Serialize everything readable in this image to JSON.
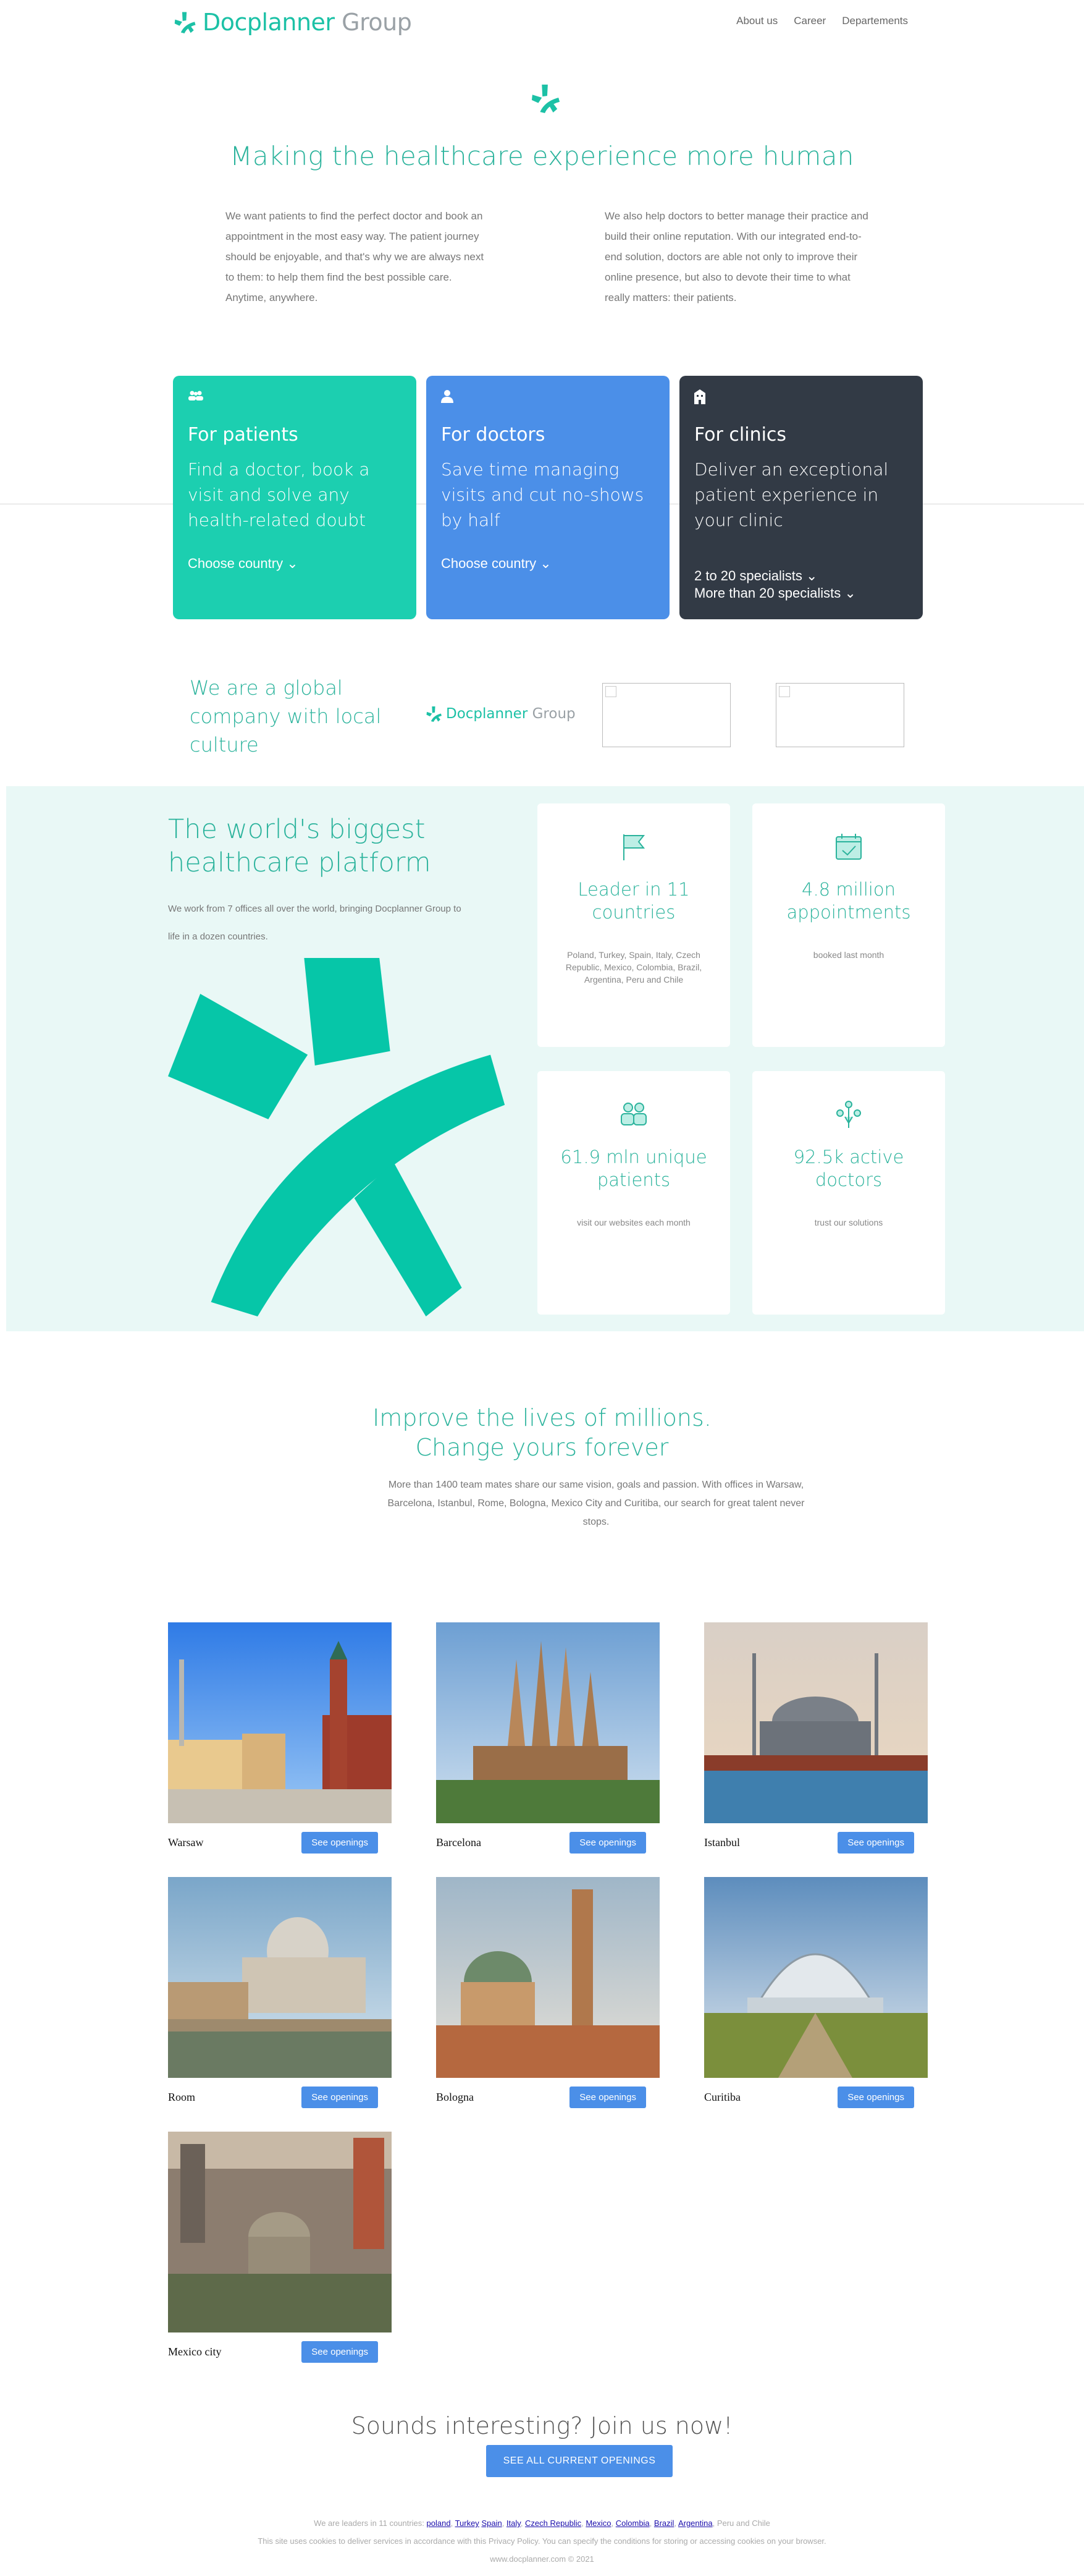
{
  "header": {
    "brand_main": "Docplanner",
    "brand_group": " Group",
    "nav": [
      "About us",
      "Career",
      "Departements"
    ]
  },
  "hero": {
    "title": "Making the healthcare experience more human",
    "intro_left": "We want patients to find the perfect doctor and book an appointment in the most easy way. The patient journey should be enjoyable, and that's why we are always next to them: to help them find the best possible care. Anytime, anywhere.",
    "intro_right": "We also help doctors to better manage their practice and build their online reputation. With our integrated end-to-end solution, doctors are able not only to improve their online presence, but also to devote their time to what really matters: their patients."
  },
  "cards": [
    {
      "title": "For patients",
      "text": "Find a doctor, book a visit and solve any health-related doubt",
      "cta": "Choose country",
      "color": "#1ccfb0",
      "icon": "people-icon"
    },
    {
      "title": "For doctors",
      "text": "Save time managing visits and cut no-shows by half",
      "cta": "Choose country",
      "color": "#4b8fe8",
      "icon": "doctor-icon"
    },
    {
      "title": "For clinics",
      "text": "Deliver an exceptional patient experience in your clinic",
      "cta": "2 to 20 specialists",
      "cta2": "More than 20 specialists",
      "color": "#323a45",
      "icon": "building-icon"
    }
  ],
  "global": {
    "title": "We are a global company with local culture",
    "brand_main": "Docplanner",
    "brand_group": " Group"
  },
  "platform": {
    "title": "The world's biggest healthcare platform",
    "text": "We work from 7 offices all over the world, bringing Docplanner Group to life in a dozen countries.",
    "stats": [
      {
        "title": "Leader in 11 countries",
        "desc": "Poland, Turkey, Spain, Italy, Czech Republic, Mexico, Colombia, Brazil, Argentina, Peru and Chile",
        "icon": "flag-icon"
      },
      {
        "title": "4.8 million appointments",
        "desc": "booked last month",
        "icon": "calendar-check-icon"
      },
      {
        "title": "61.9 mln unique patients",
        "desc": "visit our websites each month",
        "icon": "patients-icon"
      },
      {
        "title": "92.5k active doctors",
        "desc": "trust our solutions",
        "icon": "doctors-icon"
      }
    ]
  },
  "join": {
    "title_line1": "Improve the lives of millions.",
    "title_line2": "Change yours forever",
    "text": "More than 1400 team mates share our same vision, goals and passion. With offices in Warsaw, Barcelona, Istanbul, Rome, Bologna, Mexico City and Curitiba, our search for great talent never stops."
  },
  "cities": [
    {
      "name": "Warsaw",
      "button": "See openings"
    },
    {
      "name": "Barcelona",
      "button": "See openings"
    },
    {
      "name": "Istanbul",
      "button": "See openings"
    },
    {
      "name": "Room",
      "button": "See openings"
    },
    {
      "name": "Bologna",
      "button": "See openings"
    },
    {
      "name": "Curitiba",
      "button": "See openings"
    },
    {
      "name": "Mexico city",
      "button": "See openings"
    }
  ],
  "cta": {
    "title": "Sounds interesting? Join us now!",
    "button": "SEE ALL CURRENT OPENINGS"
  },
  "footer": {
    "leaders_prefix": "We are leaders in 11 countries:",
    "countries": [
      "poland",
      "Turkey",
      "Spain",
      "Italy",
      "Czech Republic",
      "Mexico",
      "Colombia",
      "Brazil",
      "Argentina"
    ],
    "leaders_suffix": "Peru and Chile",
    "cookies": "This site uses cookies to deliver services in accordance with this Privacy Policy. You can specify the conditions for storing or accessing cookies on your browser.",
    "copyright": "www.docplanner.com © 2021"
  },
  "colors": {
    "accent": "#1cc1a6",
    "title": "#2bb39c",
    "blue": "#4b8fe8",
    "dark": "#323a45"
  }
}
